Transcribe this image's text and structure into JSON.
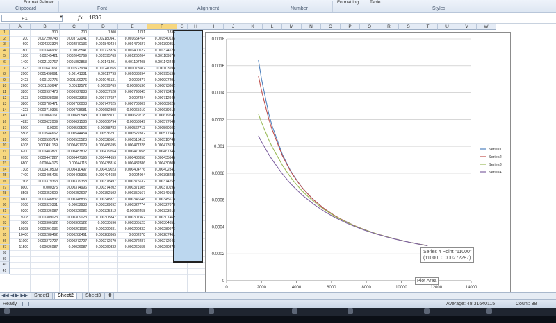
{
  "ribbon": {
    "groups": [
      "Clipboard",
      "Font",
      "Alignment",
      "Number",
      "Styles"
    ],
    "top_items": [
      "Format Painter",
      "Formatting",
      "Table"
    ]
  },
  "formula_bar": {
    "name_box": "F1",
    "fx": "fx",
    "value": "1836"
  },
  "columns": [
    "A",
    "B",
    "C",
    "D",
    "E",
    "F",
    "G",
    "H",
    "I",
    "J",
    "K",
    "L",
    "M",
    "N",
    "O",
    "P",
    "Q",
    "R",
    "S",
    "T",
    "U",
    "V",
    "W"
  ],
  "selected_column": "F",
  "sheet": {
    "row_count": 41,
    "rows": [
      [
        "",
        "300",
        "700",
        "1300",
        "1711",
        "1836"
      ],
      [
        "200",
        "0.007290743",
        "0.003722041",
        "0.002180941",
        "0.001654764",
        "0.001540135"
      ],
      [
        "600",
        "0.004323324",
        "0.002870136",
        "0.001849434",
        "0.001470927",
        "0.001390851"
      ],
      [
        "800",
        "0.00346937",
        "0.0025541",
        "0.001723376",
        "0.001400522",
        "0.001324528"
      ],
      [
        "1200",
        "0.00245421",
        "0.002045769",
        "0.001595763",
        "0.001260204",
        "0.001189574"
      ],
      [
        "1400",
        "0.002122767",
        "0.001852853",
        "0.00141291",
        "0.001197408",
        "0.001142244"
      ],
      [
        "1823",
        "0.001641661",
        "0.001523934",
        "0.001240765",
        "0.001078602",
        "0.00103594"
      ],
      [
        "2000",
        "0.001498691",
        "0.00141381",
        "0.00117793",
        "0.001033394",
        "0.000995135"
      ],
      [
        "2423",
        "0.00123775",
        "0.001199276",
        "0.001046131",
        "0.0009377",
        "0.000907291"
      ],
      [
        "2600",
        "0.001153647",
        "0.00112572",
        "0.00099769",
        "0.00090136",
        "0.000873862"
      ],
      [
        "3200",
        "0.000937478",
        "0.000927883",
        "0.000857528",
        "0.000793045",
        "0.000773429"
      ],
      [
        "3623",
        "0.000828038",
        "0.000823363",
        "0.000777027",
        "0.0007284",
        "0.000712949"
      ],
      [
        "3800",
        "0.000789471",
        "0.000786008",
        "0.000747025",
        "0.000703809",
        "0.000689825"
      ],
      [
        "4223",
        "0.000710395",
        "0.000708681",
        "0.000682808",
        "0.00065019",
        "0.000639918"
      ],
      [
        "4400",
        "0.00068161",
        "0.000680548",
        "0.000658711",
        "0.000629718",
        "0.000619749"
      ],
      [
        "4823",
        "0.000622009",
        "0.000621586",
        "0.000606794",
        "0.00058649",
        "0.000577048"
      ],
      [
        "5000",
        "0.0006",
        "0.000599526",
        "0.00058783",
        "0.000567713",
        "0.000560606"
      ],
      [
        "5508",
        "0.000544662",
        "0.000544454",
        "0.000536791",
        "0.000522882",
        "0.000517945"
      ],
      [
        "5600",
        "0.000535714",
        "0.000535523",
        "0.000528501",
        "0.000515413",
        "0.000510746"
      ],
      [
        "6108",
        "0.000491159",
        "0.000491079",
        "0.000486695",
        "0.000477328",
        "0.000473523"
      ],
      [
        "6200",
        "0.000483871",
        "0.000483802",
        "0.000479764",
        "0.000470958",
        "0.000467345"
      ],
      [
        "6708",
        "0.000447227",
        "0.000447196",
        "0.000444659",
        "0.000438358",
        "0.000435645"
      ],
      [
        "6800",
        "0.00044176",
        "0.00044115",
        "0.000438816",
        "0.000432886",
        "0.000430309"
      ],
      [
        "7308",
        "0.000410509",
        "0.000410497",
        "0.000409023",
        "0.000404776",
        "0.000402841"
      ],
      [
        "7400",
        "0.000405405",
        "0.000405395",
        "0.000404038",
        "0.0004004",
        "0.000398283"
      ],
      [
        "7908",
        "0.000379363",
        "0.000379358",
        "0.000378497",
        "0.000375632",
        "0.000374252"
      ],
      [
        "8000",
        "0.000375",
        "0.000374996",
        "0.000374202",
        "0.000371505",
        "0.000370195"
      ],
      [
        "8508",
        "0.000352609",
        "0.000352607",
        "0.000352102",
        "0.000350167",
        "0.000349183"
      ],
      [
        "8600",
        "0.000348837",
        "0.000348836",
        "0.000348371",
        "0.000346548",
        "0.000345614"
      ],
      [
        "9108",
        "0.000329381",
        "0.00032938",
        "0.000329092",
        "0.000327774",
        "0.000327073"
      ],
      [
        "9200",
        "0.000326087",
        "0.000326086",
        "0.000325812",
        "0.00032458",
        "0.000323914"
      ],
      [
        "9708",
        "0.000309023",
        "0.000309023",
        "0.000308847",
        "0.000307962",
        "0.000307462"
      ],
      [
        "9800",
        "0.000306122",
        "0.000306122",
        "0.00030596",
        "0.000305123",
        "0.000304651"
      ],
      [
        "10308",
        "0.000291036",
        "0.000291036",
        "0.000290931",
        "0.000290332",
        "0.000289976"
      ],
      [
        "10400",
        "0.000288462",
        "0.000288461",
        "0.000288365",
        "0.0002878",
        "0.000287461"
      ],
      [
        "11000",
        "0.000272727",
        "0.000272727",
        "0.000272679",
        "0.000272287",
        "0.000272045"
      ],
      [
        "11500",
        "0.00026087",
        "0.00026087",
        "0.000260832",
        "0.000260555",
        "0.000260373"
      ]
    ]
  },
  "chart_data": {
    "type": "line",
    "xlim": [
      0,
      14000
    ],
    "ylim": [
      0,
      0.0018
    ],
    "x_ticks": [
      "0",
      "2000",
      "4000",
      "6000",
      "8000",
      "10000",
      "12000",
      "14000"
    ],
    "y_ticks": [
      "0",
      "0.0002",
      "0.0004",
      "0.0006",
      "0.0008",
      "0.001",
      "0.0012",
      "0.0014",
      "0.0016",
      "0.0018"
    ],
    "legend_position": "right",
    "grid": true,
    "x": [
      1823,
      2000,
      2423,
      2600,
      3200,
      3623,
      3800,
      4223,
      4400,
      4823,
      5000,
      5508,
      5600,
      6108,
      6200,
      6708,
      6800,
      7308,
      7400,
      7908,
      8000,
      8508,
      8600,
      9108,
      9200,
      9708,
      9800,
      10308,
      10400,
      11000,
      11500
    ],
    "series": [
      {
        "name": "Series1",
        "color": "#4f81bd",
        "values": [
          0.001641661,
          0.001498691,
          0.00123775,
          0.001153647,
          0.000937478,
          0.000828038,
          0.000789471,
          0.000710395,
          0.00068161,
          0.000622009,
          0.0006,
          0.000544662,
          0.000535714,
          0.000491159,
          0.000483871,
          0.000447227,
          0.00044176,
          0.000410509,
          0.000405405,
          0.000379363,
          0.000375,
          0.000352609,
          0.000348837,
          0.000329381,
          0.000326087,
          0.000309023,
          0.000306122,
          0.000291036,
          0.000288462,
          0.000272727,
          0.00026087
        ]
      },
      {
        "name": "Series2",
        "color": "#c0504d",
        "values": [
          0.001523934,
          0.00141381,
          0.001199276,
          0.00112572,
          0.000927883,
          0.000823363,
          0.000786008,
          0.000708681,
          0.000680548,
          0.000621586,
          0.000599526,
          0.000544454,
          0.000535523,
          0.000491079,
          0.000483802,
          0.000447196,
          0.00044115,
          0.000410497,
          0.000405395,
          0.000379358,
          0.000374996,
          0.000352607,
          0.000348836,
          0.00032938,
          0.000326086,
          0.000309023,
          0.000306122,
          0.000291036,
          0.000288461,
          0.000272727,
          0.00026087
        ]
      },
      {
        "name": "Series3",
        "color": "#9bbb59",
        "values": [
          0.001240765,
          0.00117793,
          0.001046131,
          0.00099769,
          0.000857528,
          0.000777027,
          0.000747025,
          0.000682808,
          0.000658711,
          0.000606794,
          0.00058783,
          0.000536791,
          0.000528501,
          0.000486695,
          0.000479764,
          0.000444659,
          0.000438816,
          0.000409023,
          0.000404038,
          0.000378497,
          0.000374202,
          0.000352102,
          0.000348371,
          0.000329092,
          0.000325812,
          0.000308847,
          0.00030596,
          0.000290931,
          0.000288365,
          0.000272679,
          0.000260832
        ]
      },
      {
        "name": "Series4",
        "color": "#8064a2",
        "values": [
          0.001078602,
          0.001033394,
          0.0009377,
          0.00090136,
          0.000793045,
          0.0007284,
          0.000703809,
          0.00065019,
          0.000629718,
          0.00058649,
          0.000567713,
          0.000522882,
          0.000515413,
          0.000477328,
          0.000470958,
          0.000438358,
          0.000432886,
          0.000404776,
          0.0004004,
          0.000375632,
          0.000371505,
          0.000350167,
          0.000346548,
          0.000327774,
          0.00032458,
          0.000307962,
          0.000305123,
          0.000290332,
          0.0002878,
          0.000272287,
          0.000260555
        ]
      }
    ]
  },
  "tooltip": {
    "line1": "Series 4 Point \"11000\"",
    "line2": "(11000, 0.000272287)"
  },
  "plot_area_tip": "Plot Area",
  "tabs": [
    "Sheet1",
    "Sheet2",
    "Sheet3"
  ],
  "active_tab": "Sheet2",
  "status": {
    "mode": "Ready",
    "average": "Average: 48.31640115",
    "count": "Count: 38"
  }
}
